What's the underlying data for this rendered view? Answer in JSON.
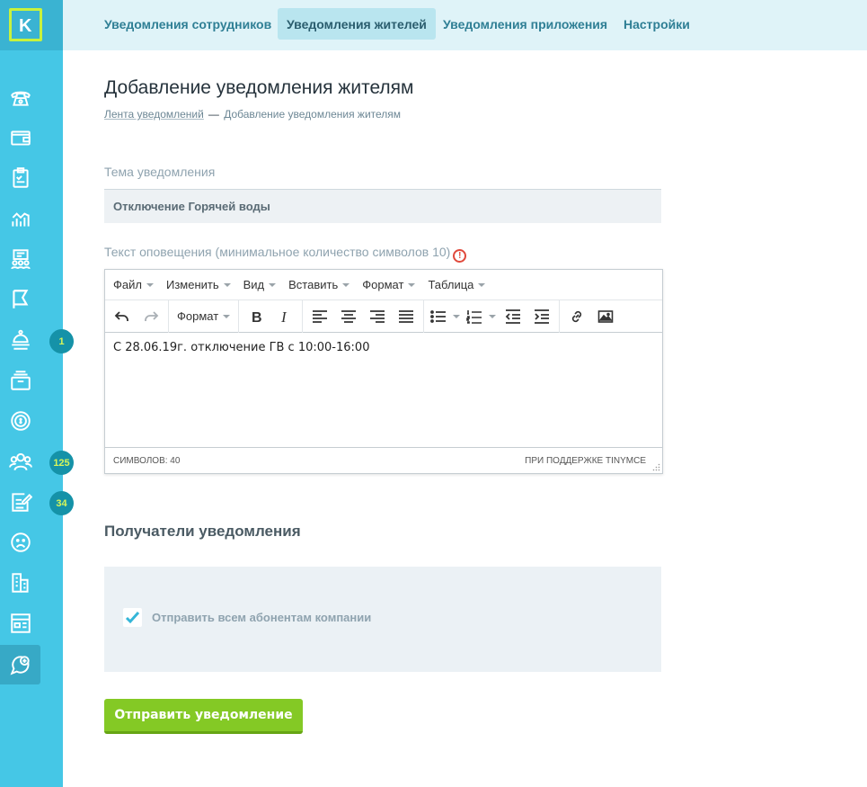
{
  "logo_letter": "K",
  "tabs": [
    {
      "label": "Уведомления сотрудников",
      "active": false
    },
    {
      "label": "Уведомления жителей",
      "active": true
    },
    {
      "label": "Уведомления приложения",
      "active": false
    },
    {
      "label": "Настройки",
      "active": false
    }
  ],
  "sidebar": {
    "icons": [
      "phone-icon",
      "wallet-icon",
      "clipboard-icon",
      "analytics-icon",
      "team-icon",
      "flag-icon",
      "concierge-icon",
      "archive-icon",
      "money-icon",
      "users-icon",
      "edit-note-icon",
      "sad-face-icon",
      "buildings-icon",
      "browser-icon",
      "chat-add-icon"
    ],
    "badges": {
      "concierge": "1",
      "users": "125",
      "edit_note": "34"
    }
  },
  "page": {
    "title": "Добавление уведомления жителям",
    "breadcrumb_link": "Лента уведомлений",
    "breadcrumb_separator": "—",
    "breadcrumb_current": "Добавление уведомления жителям"
  },
  "subject": {
    "label": "Тема уведомления",
    "value": "Отключение Горячей воды"
  },
  "message": {
    "label": "Текст оповещения (минимальное количество символов 10)",
    "warning_glyph": "!",
    "editor": {
      "menus": [
        "Файл",
        "Изменить",
        "Вид",
        "Вставить",
        "Формат",
        "Таблица"
      ],
      "format_select": "Формат",
      "content": "С 28.06.19г. отключение ГВ с 10:00-16:00",
      "char_count": "Символов: 40",
      "powered_by": "При поддержке TinyMCE"
    }
  },
  "recipients": {
    "title": "Получатели уведомления",
    "send_all_label": "Отправить всем абонентам компании",
    "send_all_checked": true
  },
  "submit_label": "Отправить уведомление",
  "colors": {
    "sidebar": "#45c7e6",
    "accent_green": "#84c925",
    "logo_lime": "#c8f23c",
    "badge": "#1592a8",
    "warning": "#e0493c"
  }
}
